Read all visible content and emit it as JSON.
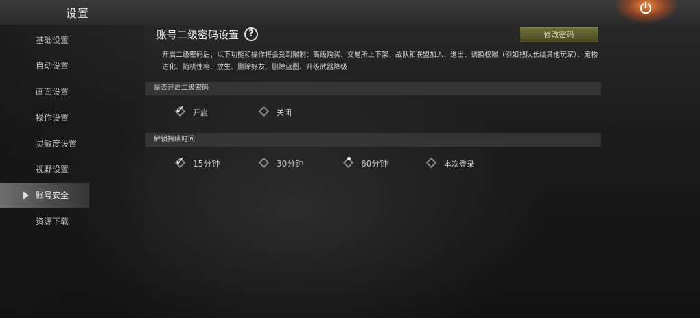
{
  "header": {
    "title": "设置"
  },
  "sidebar": {
    "items": [
      {
        "label": "基础设置",
        "active": false
      },
      {
        "label": "自动设置",
        "active": false
      },
      {
        "label": "画面设置",
        "active": false
      },
      {
        "label": "操作设置",
        "active": false
      },
      {
        "label": "灵敏度设置",
        "active": false
      },
      {
        "label": "视野设置",
        "active": false
      },
      {
        "label": "账号安全",
        "active": true
      },
      {
        "label": "资源下载",
        "active": false
      }
    ]
  },
  "panel": {
    "title": "账号二级密码设置",
    "help_icon": "?",
    "modify_button": "修改密码",
    "description": "开启二级密码后，以下功能和操作将会受到限制：高级购买、交易所上下架、战队和联盟加入、退出、调换权限（例如把队长给其他玩家）、宠物进化、随机性格、放生、删除好友、删除蓝图、升级武器降级"
  },
  "enable_section": {
    "label": "是否开启二级密码",
    "options": [
      {
        "label": "开启",
        "state": "checked"
      },
      {
        "label": "关闭",
        "state": "unchecked"
      }
    ]
  },
  "duration_section": {
    "label": "解锁持续时间",
    "options": [
      {
        "label": "15分钟",
        "state": "checked"
      },
      {
        "label": "30分钟",
        "state": "unchecked"
      },
      {
        "label": "60分钟",
        "state": "dot"
      },
      {
        "label": "本次登录",
        "state": "unchecked"
      }
    ]
  },
  "icons": {
    "power": "power-icon",
    "help": "help-icon",
    "nav_arrow": "arrow-right-icon"
  },
  "colors": {
    "accent_button": "#5d5d30",
    "active_nav": "#787878",
    "power_glow": "#ff8c3c"
  }
}
